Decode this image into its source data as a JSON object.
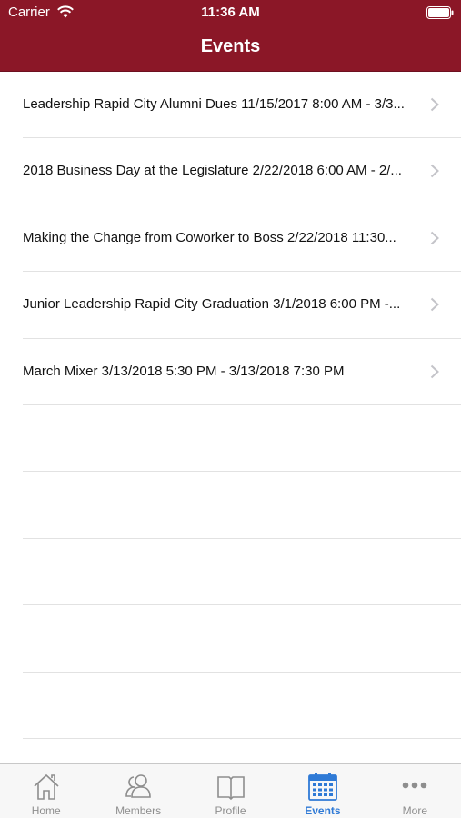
{
  "status_bar": {
    "carrier": "Carrier",
    "time": "11:36 AM"
  },
  "nav": {
    "title": "Events"
  },
  "events": [
    {
      "label": "Leadership Rapid City Alumni Dues 11/15/2017 8:00 AM - 3/3..."
    },
    {
      "label": "2018 Business Day at the Legislature 2/22/2018 6:00 AM - 2/..."
    },
    {
      "label": "Making the Change from Coworker to Boss 2/22/2018 11:30..."
    },
    {
      "label": "Junior Leadership Rapid City Graduation 3/1/2018 6:00 PM -..."
    },
    {
      "label": "March Mixer 3/13/2018 5:30 PM - 3/13/2018 7:30 PM"
    }
  ],
  "tabs": [
    {
      "label": "Home",
      "icon": "home-icon"
    },
    {
      "label": "Members",
      "icon": "members-icon"
    },
    {
      "label": "Profile",
      "icon": "profile-book-icon"
    },
    {
      "label": "Events",
      "icon": "calendar-icon",
      "active": true
    },
    {
      "label": "More",
      "icon": "more-dots-icon"
    }
  ],
  "colors": {
    "brand": "#8b1727",
    "tab_active": "#2f7ad6",
    "tab_inactive": "#8e8e8e"
  }
}
